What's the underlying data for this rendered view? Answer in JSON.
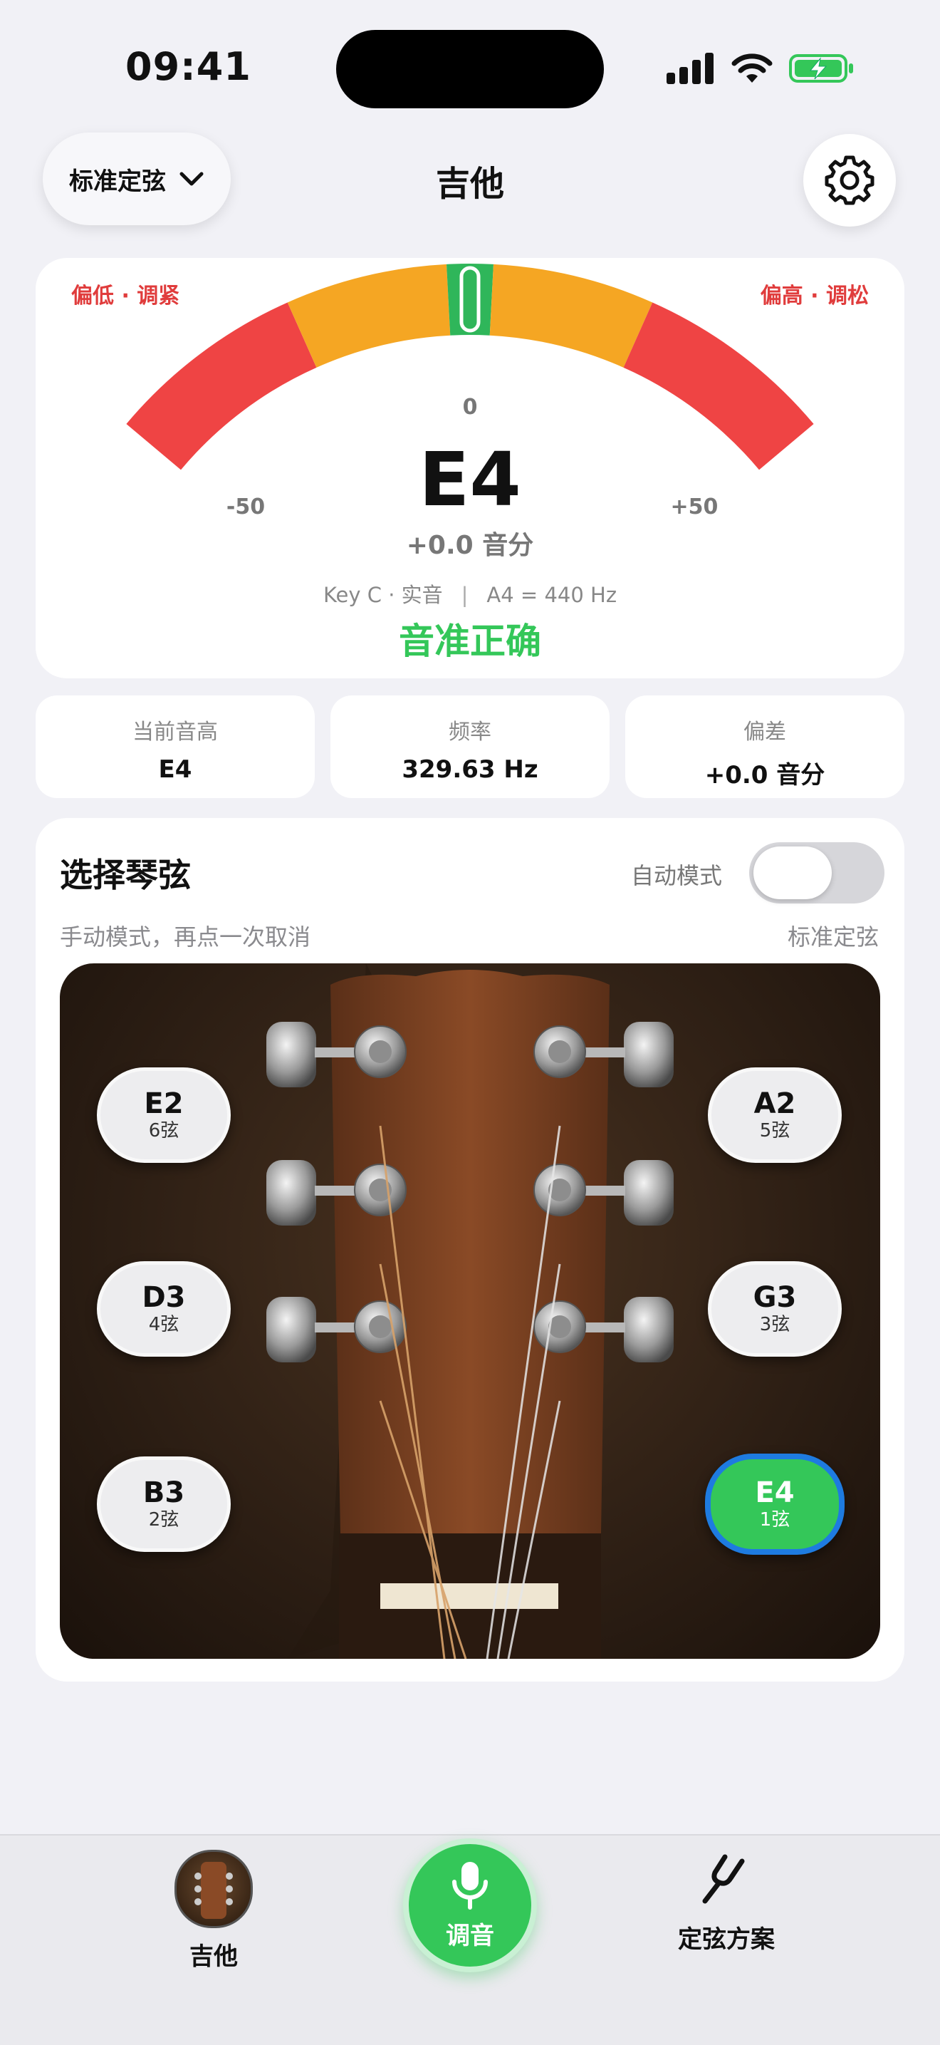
{
  "status_bar": {
    "time": "09:41"
  },
  "header": {
    "preset_button_label": "标准定弦",
    "title": "吉他",
    "settings_icon": "gear-icon"
  },
  "gauge": {
    "flat_label": "偏低 · 调紧",
    "sharp_label": "偏高 · 调松",
    "tick_zero": "0",
    "tick_min": "-50",
    "tick_max": "+50",
    "note": "E4",
    "cents": "+0.0 音分",
    "key_info": "Key C · 实音",
    "separator": "|",
    "reference": "A4 = 440 Hz",
    "status": "音准正确",
    "deviation_cents": 0,
    "colors": {
      "red": "#EF4444",
      "amber": "#F5A623",
      "green": "#2FB65A"
    }
  },
  "info": [
    {
      "label": "当前音高",
      "value": "E4"
    },
    {
      "label": "频率",
      "value": "329.63 Hz"
    },
    {
      "label": "偏差",
      "value": "+0.0 音分"
    }
  ],
  "strings_section": {
    "title": "选择琴弦",
    "auto_mode_label": "自动模式",
    "auto_mode_on": false,
    "manual_hint": "手动模式，再点一次取消",
    "tuning_name": "标准定弦",
    "strings": [
      {
        "note": "E2",
        "label": "6弦",
        "active": false
      },
      {
        "note": "A2",
        "label": "5弦",
        "active": false
      },
      {
        "note": "D3",
        "label": "4弦",
        "active": false
      },
      {
        "note": "G3",
        "label": "3弦",
        "active": false
      },
      {
        "note": "B3",
        "label": "2弦",
        "active": false
      },
      {
        "note": "E4",
        "label": "1弦",
        "active": true
      }
    ]
  },
  "tabbar": {
    "guitar_label": "吉他",
    "tune_label": "调音",
    "presets_label": "定弦方案",
    "accent": "#34C759"
  }
}
